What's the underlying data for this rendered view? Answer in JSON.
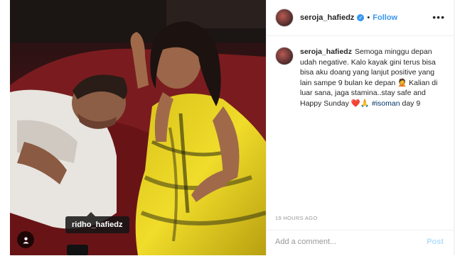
{
  "post": {
    "username": "seroja_hafiedz",
    "follow_label": "Follow",
    "dot": "•",
    "more_label": "•••",
    "caption_lines": [
      "Semoga minggu depan udah negative. Kalo kayak gini terus bisa bisa aku doang yang lanjut positive yang lain sampe 9 bulan ke depan 🤦 Kalian di luar sana, jaga stamina..stay safe and Happy Sunday ❤️🙏 ",
      "#isoman",
      " day 9"
    ],
    "time": "19 HOURS AGO",
    "comment_placeholder": "Add a comment...",
    "post_label": "Post"
  },
  "photo": {
    "tagged_user": "ridho_hafiedz",
    "user_tag_icon": "person-icon"
  },
  "colors": {
    "link_blue": "#3897f0",
    "post_disabled": "#b2dffc",
    "hashtag": "#003569"
  }
}
